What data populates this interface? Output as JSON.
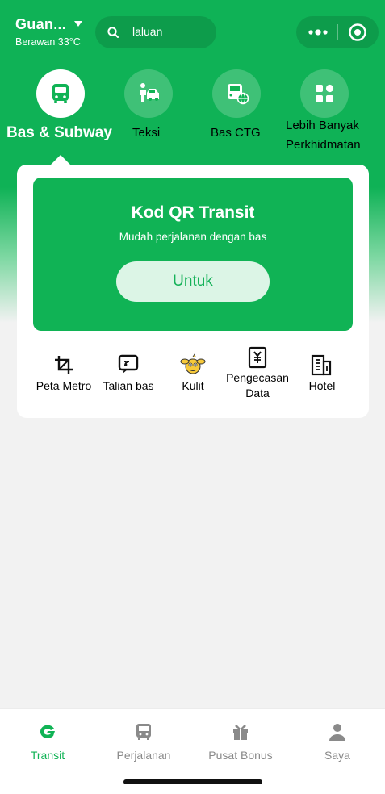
{
  "header": {
    "city": "Guan...",
    "weather": "Berawan 33°C",
    "search_placeholder": "laluan"
  },
  "categories": [
    {
      "label": "Bas & Subway",
      "icon": "bus-icon",
      "active": true
    },
    {
      "label": "Teksi",
      "icon": "taxi-icon",
      "active": false
    },
    {
      "label": "Bas CTG",
      "icon": "globe-bus-icon",
      "active": false
    },
    {
      "label": "Lebih Banyak Perkhidmatan",
      "label_lines": [
        "Lebih Banyak",
        "Perkhidmatan"
      ],
      "icon": "grid-icon",
      "active": false
    }
  ],
  "qr_card": {
    "title": "Kod QR Transit",
    "subtitle": "Mudah perjalanan dengan bas",
    "button_label": "Untuk"
  },
  "tools": [
    {
      "label": "Peta Metro",
      "icon": "metro-map-icon"
    },
    {
      "label": "Talian bas",
      "icon": "bus-line-icon"
    },
    {
      "label": "Kulit",
      "icon": "skin-mascot-icon"
    },
    {
      "label": "Pengecasan Data",
      "label_lines": [
        "Pengecasan",
        "Data"
      ],
      "icon": "yuan-receipt-icon"
    },
    {
      "label": "Hotel",
      "icon": "hotel-icon"
    }
  ],
  "tabbar": [
    {
      "label": "Transit",
      "icon": "transit-logo-icon",
      "active": true
    },
    {
      "label": "Perjalanan",
      "icon": "bus-icon",
      "active": false
    },
    {
      "label": "Pusat Bonus",
      "icon": "gift-icon",
      "active": false
    },
    {
      "label": "Saya",
      "icon": "person-icon",
      "active": false
    }
  ],
  "colors": {
    "brand_green": "#10b355",
    "button_bg": "#dcf5e6",
    "tab_inactive": "#8a8a8a"
  }
}
